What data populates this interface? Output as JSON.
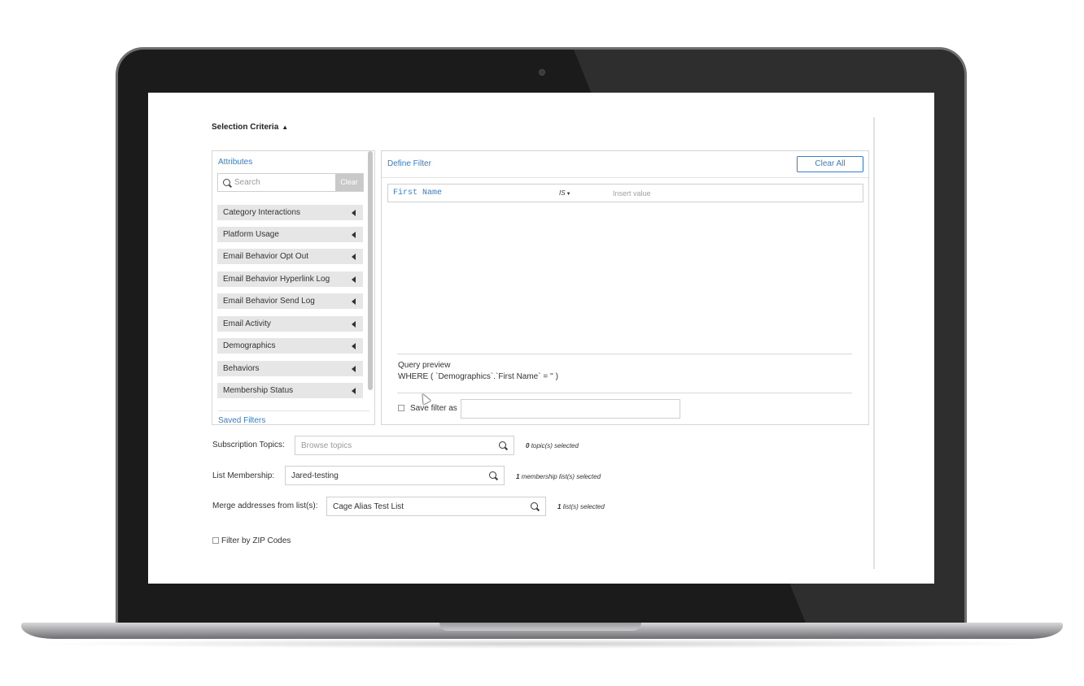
{
  "selection_criteria": {
    "title": "Selection Criteria",
    "caret": "▲"
  },
  "attributes": {
    "label": "Attributes",
    "search_placeholder": "Search",
    "clear_label": "Clear",
    "items": [
      "Category Interactions",
      "Platform Usage",
      "Email Behavior Opt Out",
      "Email Behavior Hyperlink Log",
      "Email Behavior Send Log",
      "Email Activity",
      "Demographics",
      "Behaviors",
      "Membership Status"
    ],
    "saved_filters_label": "Saved Filters"
  },
  "define_filter": {
    "label": "Define Filter",
    "clear_all_label": "Clear All",
    "row": {
      "field": "First Name",
      "operator": "IS",
      "value_placeholder": "Insert value"
    },
    "query_preview_title": "Query preview",
    "query_preview_text": "WHERE ( `Demographics`.`First Name` = '' )",
    "save_filter_label": "Save filter as"
  },
  "subscription_topics": {
    "label": "Subscription Topics:",
    "placeholder": "Browse topics",
    "count": "0",
    "count_suffix": "topic(s) selected"
  },
  "list_membership": {
    "label": "List Membership:",
    "value": "Jared-testing",
    "count": "1",
    "count_suffix": "membership list(s) selected"
  },
  "merge_addresses": {
    "label": "Merge addresses from list(s):",
    "value": "Cage Alias Test List",
    "count": "1",
    "count_suffix": "list(s) selected"
  },
  "zip_filter": {
    "label": "Filter by ZIP Codes"
  },
  "colors": {
    "accent": "#3a7dc9",
    "item_bg": "#e6e6e6",
    "frame": "#1b1b1b"
  }
}
